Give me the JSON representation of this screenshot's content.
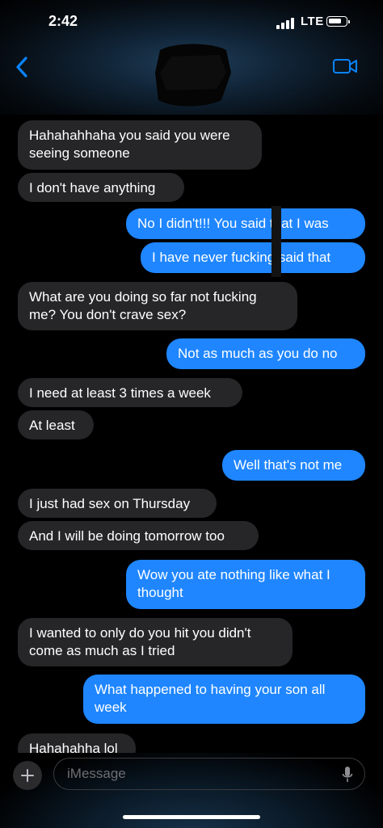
{
  "status_bar": {
    "time": "2:42",
    "network": "LTE",
    "icons": [
      "signal-bars-icon",
      "battery-icon"
    ]
  },
  "header": {
    "back_icon": "chevron-left-icon",
    "video_icon": "video-camera-icon",
    "contact_name_redacted": true
  },
  "messages": [
    {
      "direction": "incoming",
      "text": "Hahahahhaha you said you were seeing someone"
    },
    {
      "direction": "incoming",
      "text": "I don't have anything"
    },
    {
      "direction": "outgoing",
      "text": "No I didn't!!! You said that I was"
    },
    {
      "direction": "outgoing",
      "text": "I have never fucking said that"
    },
    {
      "direction": "incoming",
      "text": "What are you doing so far not fucking me? You don't crave sex?"
    },
    {
      "direction": "outgoing",
      "text": "Not as much as you do no"
    },
    {
      "direction": "incoming",
      "text": "I need at least 3 times a week"
    },
    {
      "direction": "incoming",
      "text": "At least"
    },
    {
      "direction": "outgoing",
      "text": "Well that's not me"
    },
    {
      "direction": "incoming",
      "text": "I just had sex on Thursday"
    },
    {
      "direction": "incoming",
      "text": "And I will be doing tomorrow too"
    },
    {
      "direction": "outgoing",
      "text": "Wow you ate nothing like what I thought"
    },
    {
      "direction": "incoming",
      "text": "I wanted to only do you hit you didn't come as much as I tried"
    },
    {
      "direction": "outgoing",
      "text": "What happened to having your son all week"
    },
    {
      "direction": "incoming",
      "text": "Hahahahha lol"
    }
  ],
  "composer": {
    "placeholder": "iMessage",
    "plus_icon": "plus-icon",
    "mic_icon": "microphone-icon"
  },
  "colors": {
    "outgoing_bubble": "#1f86ff",
    "incoming_bubble": "#262628",
    "accent": "#0a84ff",
    "background": "#000000"
  }
}
